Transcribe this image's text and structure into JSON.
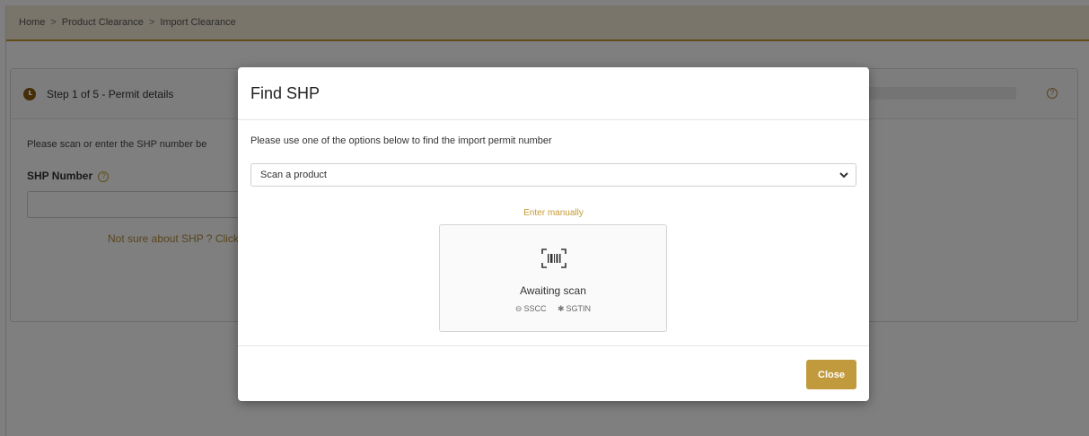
{
  "breadcrumb": {
    "home": "Home",
    "separator": ">",
    "level1": "Product Clearance",
    "level2": "Import Clearance"
  },
  "step": {
    "title": "Step 1 of 5 - Permit details",
    "help_glyph": "?",
    "instruction": "Please scan or enter the SHP number be",
    "shp_label": "SHP Number",
    "not_sure": "Not sure about SHP ? Click",
    "progress_fraction": 0.0
  },
  "modal": {
    "title": "Find SHP",
    "instruction": "Please use one of the options below to find the import permit number",
    "select_value": "Scan a product",
    "enter_manually": "Enter manually",
    "awaiting_text": "Awaiting scan",
    "format_sscc": "SSCC",
    "format_sgtin": "SGTIN",
    "close_label": "Close"
  },
  "colors": {
    "accent": "#c29a3e",
    "breadcrumb_bg": "#f3ead6"
  },
  "icons": {
    "clock": "clock-icon",
    "barcode": "barcode-scan-icon",
    "chevron": "chevron-down-icon",
    "help": "help-circle-icon"
  }
}
